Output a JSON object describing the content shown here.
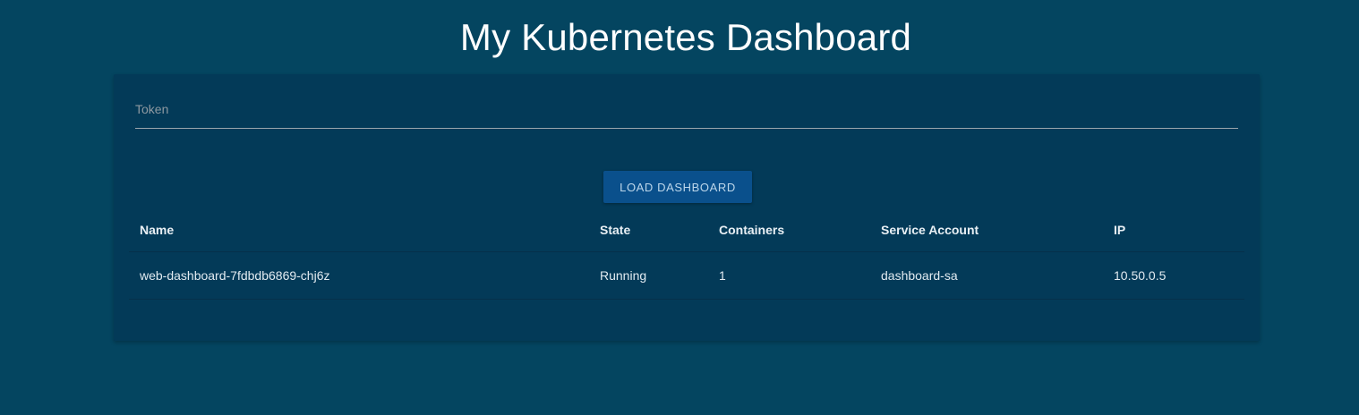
{
  "header": {
    "title": "My Kubernetes Dashboard"
  },
  "token": {
    "placeholder": "Token",
    "value": ""
  },
  "actions": {
    "load_label": "LOAD DASHBOARD"
  },
  "table": {
    "columns": [
      "Name",
      "State",
      "Containers",
      "Service Account",
      "IP"
    ],
    "rows": [
      {
        "name": "web-dashboard-7fdbdb6869-chj6z",
        "state": "Running",
        "containers": "1",
        "service_account": "dashboard-sa",
        "ip": "10.50.0.5"
      }
    ]
  },
  "colors": {
    "page_background": "#044560",
    "card_background": "#033a58",
    "button_background": "#0a508c"
  }
}
